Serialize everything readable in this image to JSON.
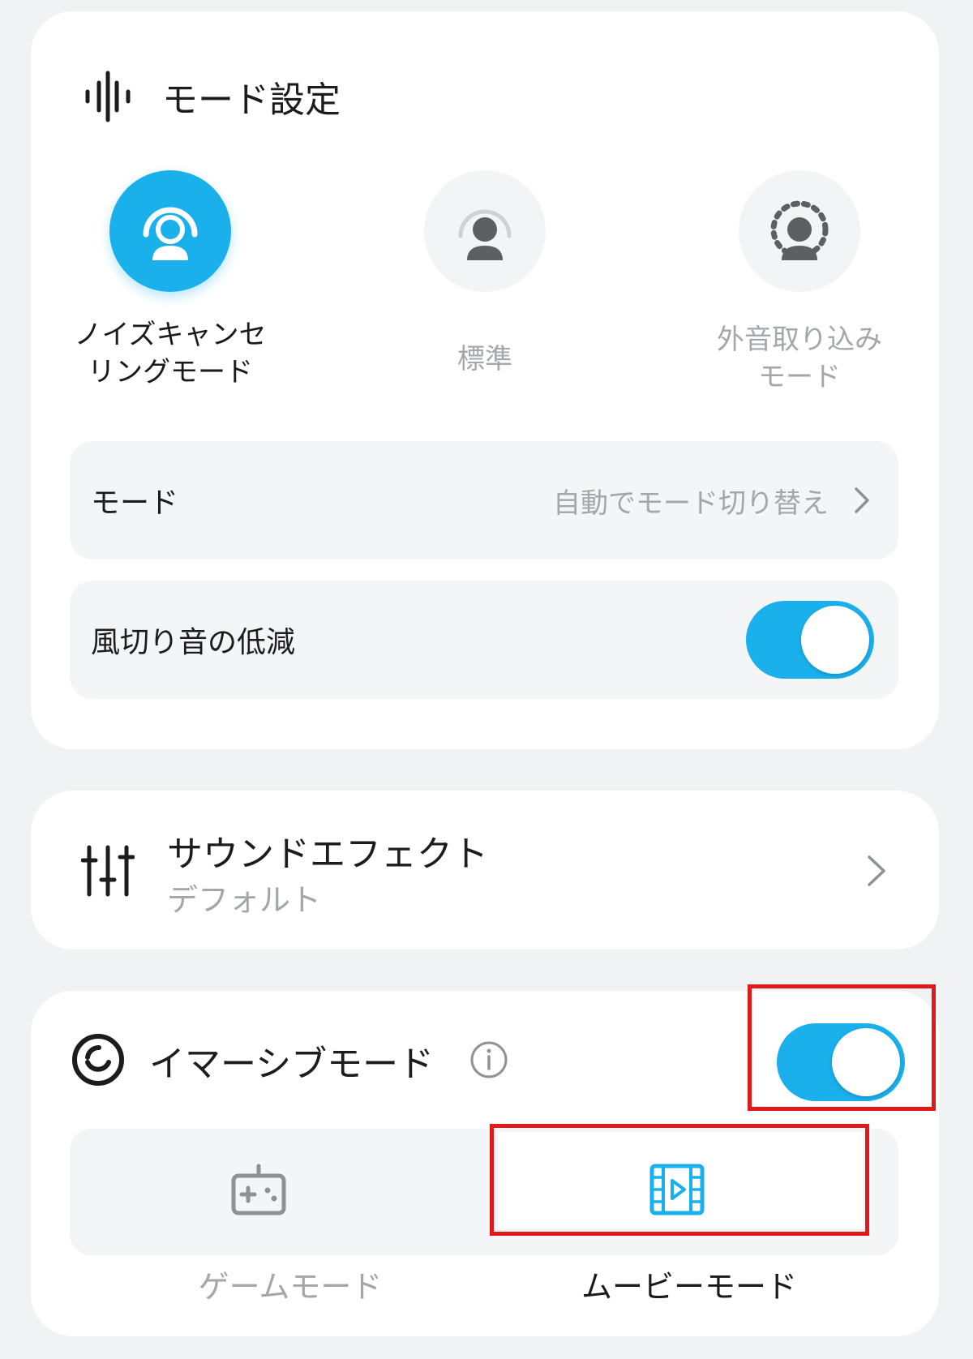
{
  "mode_settings": {
    "title": "モード設定",
    "title_icon": "waveform-icon",
    "modes": [
      {
        "label_line1": "ノイズキャンセ",
        "label_line2": "リングモード",
        "icon": "noise-cancel-icon",
        "active": true
      },
      {
        "label_line1": "標準",
        "label_line2": "",
        "icon": "standard-mode-icon",
        "active": false
      },
      {
        "label_line1": "外音取り込み",
        "label_line2": "モード",
        "icon": "ambient-sound-icon",
        "active": false
      }
    ],
    "mode_row": {
      "label": "モード",
      "value": "自動でモード切り替え"
    },
    "wind_row": {
      "label": "風切り音の低減",
      "toggle_on": true
    }
  },
  "sound_effect": {
    "title": "サウンドエフェクト",
    "subtitle": "デフォルト",
    "icon": "equalizer-sliders-icon"
  },
  "immersive": {
    "title": "イマーシブモード",
    "icon": "immersive-ring-icon",
    "toggle_on": true,
    "options": [
      {
        "label": "ゲームモード",
        "icon": "gamepad-icon",
        "selected": false
      },
      {
        "label": "ムービーモード",
        "icon": "film-play-icon",
        "selected": true
      }
    ]
  },
  "colors": {
    "accent": "#19b0ec",
    "highlight": "#e01a1a",
    "muted_text": "#a3a6ab",
    "background": "#f1f2f4"
  }
}
